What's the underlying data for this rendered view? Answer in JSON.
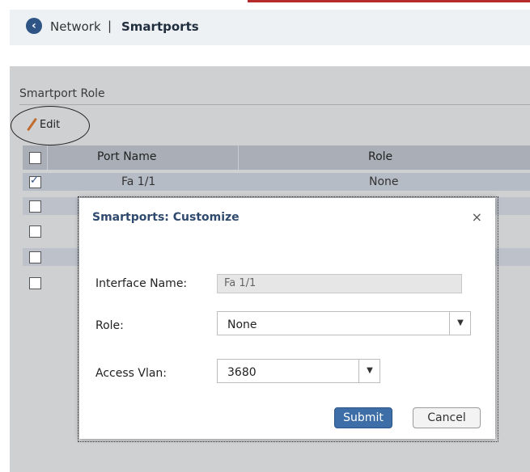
{
  "header": {
    "breadcrumb_root": "Network",
    "breadcrumb_sep": "|",
    "breadcrumb_current": "Smartports"
  },
  "section": {
    "title": "Smartport Role",
    "edit_label": "Edit"
  },
  "table": {
    "columns": [
      "Port Name",
      "Role"
    ],
    "rows": [
      {
        "port": "Fa 1/1",
        "role": "None",
        "checked": true
      },
      {
        "port": "",
        "role": "",
        "checked": false
      },
      {
        "port": "",
        "role": "",
        "checked": false
      },
      {
        "port": "",
        "role": "",
        "checked": false
      },
      {
        "port": "",
        "role": "",
        "checked": false
      }
    ]
  },
  "modal": {
    "title": "Smartports: Customize",
    "close": "×",
    "interface_label": "Interface Name:",
    "interface_value": "Fa 1/1",
    "role_label": "Role:",
    "role_value": "None",
    "vlan_label": "Access Vlan:",
    "vlan_value": "3680",
    "dropdown_arrow": "▼",
    "submit": "Submit",
    "cancel": "Cancel"
  },
  "colors": {
    "accent": "#2f5486",
    "submit_bg": "#3d6ea8",
    "header_bg": "#a9aeb7"
  }
}
